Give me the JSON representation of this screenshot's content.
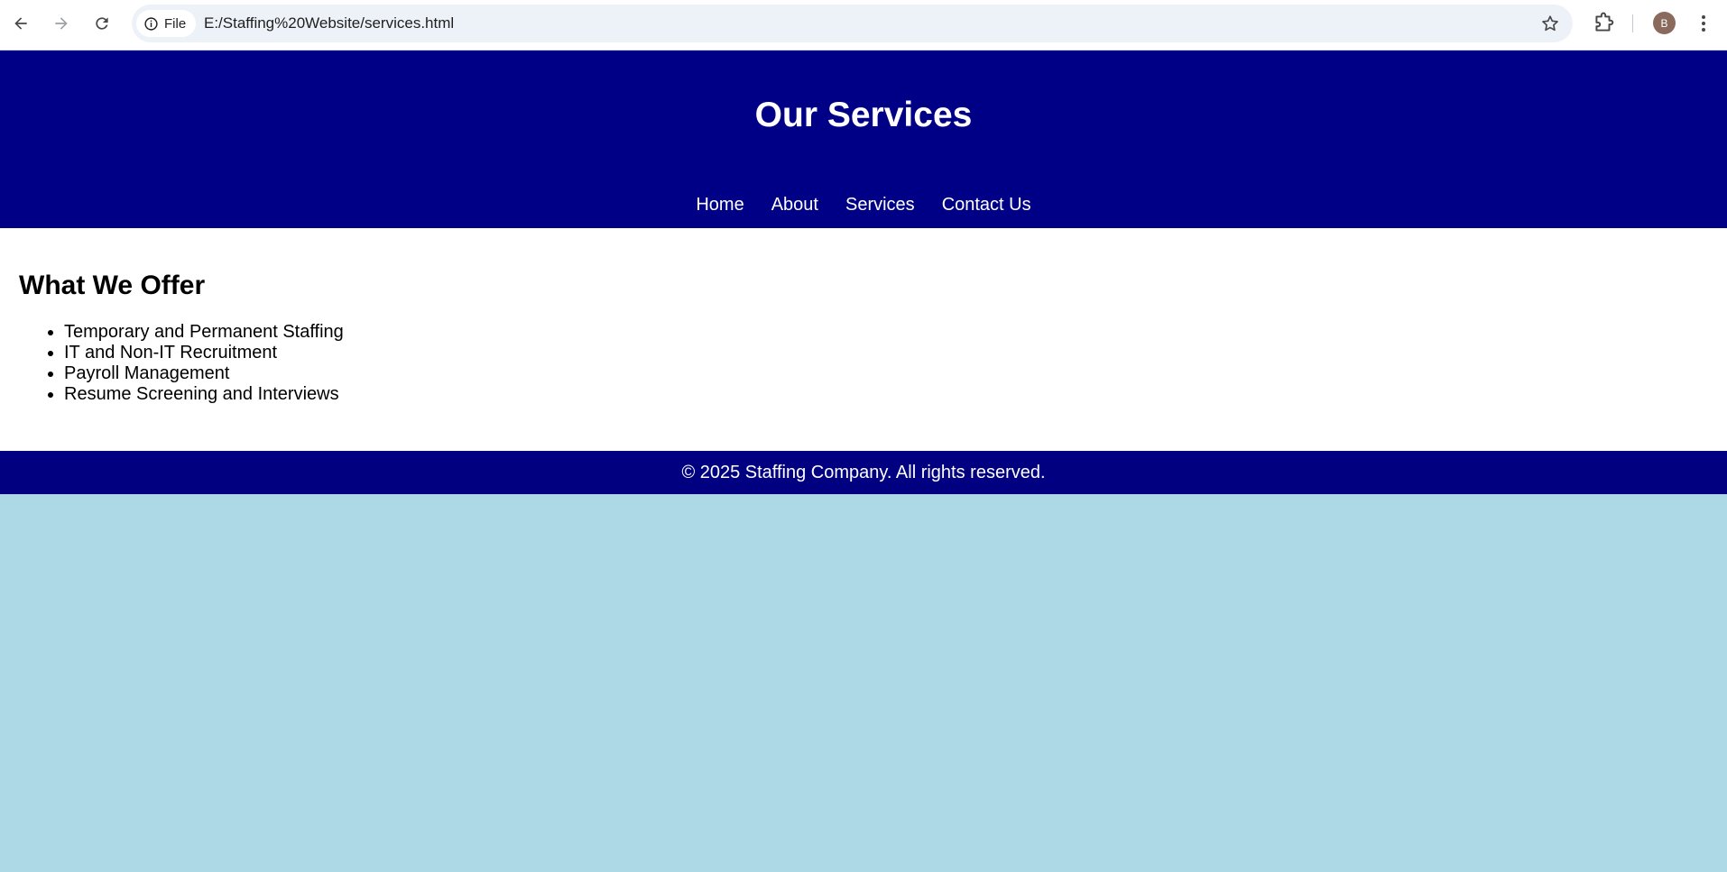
{
  "browser": {
    "site_chip_label": "File",
    "url": "E:/Staffing%20Website/services.html",
    "profile_initial": "B",
    "icons": {
      "back": "arrow-left-icon",
      "forward": "arrow-right-icon",
      "reload": "reload-icon",
      "info": "info-icon",
      "bookmark": "star-icon",
      "extensions": "puzzle-icon",
      "menu": "kebab-menu-icon"
    }
  },
  "header": {
    "title": "Our Services",
    "nav": [
      "Home",
      "About",
      "Services",
      "Contact Us"
    ]
  },
  "main": {
    "heading": "What We Offer",
    "services": [
      "Temporary and Permanent Staffing",
      "IT and Non-IT Recruitment",
      "Payroll Management",
      "Resume Screening and Interviews"
    ]
  },
  "footer": {
    "text": "© 2025 Staffing Company. All rights reserved."
  },
  "colors": {
    "header_bg": "#000087",
    "footer_bg": "#000080",
    "page_bg": "#add8e6",
    "content_bg": "#ffffff"
  }
}
